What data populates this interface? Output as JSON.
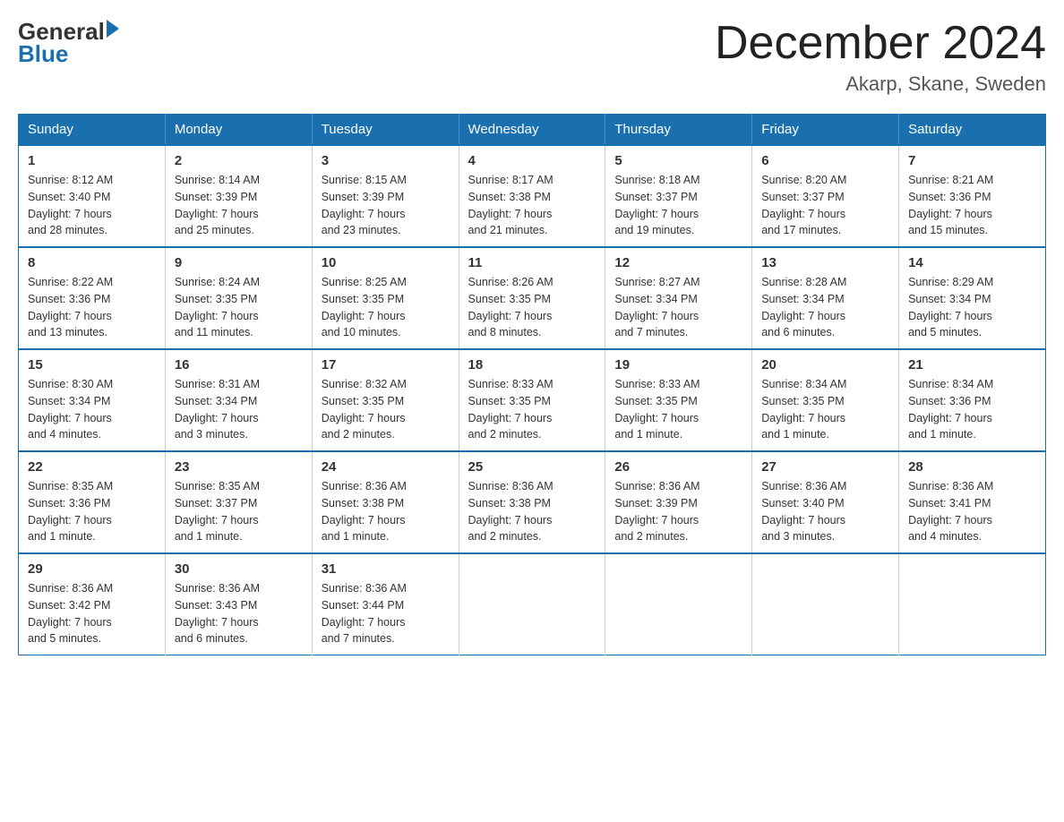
{
  "logo": {
    "general": "General",
    "blue": "Blue",
    "arrow": "▶"
  },
  "title": {
    "month_year": "December 2024",
    "location": "Akarp, Skane, Sweden"
  },
  "headers": [
    "Sunday",
    "Monday",
    "Tuesday",
    "Wednesday",
    "Thursday",
    "Friday",
    "Saturday"
  ],
  "weeks": [
    [
      {
        "day": "1",
        "info": "Sunrise: 8:12 AM\nSunset: 3:40 PM\nDaylight: 7 hours\nand 28 minutes."
      },
      {
        "day": "2",
        "info": "Sunrise: 8:14 AM\nSunset: 3:39 PM\nDaylight: 7 hours\nand 25 minutes."
      },
      {
        "day": "3",
        "info": "Sunrise: 8:15 AM\nSunset: 3:39 PM\nDaylight: 7 hours\nand 23 minutes."
      },
      {
        "day": "4",
        "info": "Sunrise: 8:17 AM\nSunset: 3:38 PM\nDaylight: 7 hours\nand 21 minutes."
      },
      {
        "day": "5",
        "info": "Sunrise: 8:18 AM\nSunset: 3:37 PM\nDaylight: 7 hours\nand 19 minutes."
      },
      {
        "day": "6",
        "info": "Sunrise: 8:20 AM\nSunset: 3:37 PM\nDaylight: 7 hours\nand 17 minutes."
      },
      {
        "day": "7",
        "info": "Sunrise: 8:21 AM\nSunset: 3:36 PM\nDaylight: 7 hours\nand 15 minutes."
      }
    ],
    [
      {
        "day": "8",
        "info": "Sunrise: 8:22 AM\nSunset: 3:36 PM\nDaylight: 7 hours\nand 13 minutes."
      },
      {
        "day": "9",
        "info": "Sunrise: 8:24 AM\nSunset: 3:35 PM\nDaylight: 7 hours\nand 11 minutes."
      },
      {
        "day": "10",
        "info": "Sunrise: 8:25 AM\nSunset: 3:35 PM\nDaylight: 7 hours\nand 10 minutes."
      },
      {
        "day": "11",
        "info": "Sunrise: 8:26 AM\nSunset: 3:35 PM\nDaylight: 7 hours\nand 8 minutes."
      },
      {
        "day": "12",
        "info": "Sunrise: 8:27 AM\nSunset: 3:34 PM\nDaylight: 7 hours\nand 7 minutes."
      },
      {
        "day": "13",
        "info": "Sunrise: 8:28 AM\nSunset: 3:34 PM\nDaylight: 7 hours\nand 6 minutes."
      },
      {
        "day": "14",
        "info": "Sunrise: 8:29 AM\nSunset: 3:34 PM\nDaylight: 7 hours\nand 5 minutes."
      }
    ],
    [
      {
        "day": "15",
        "info": "Sunrise: 8:30 AM\nSunset: 3:34 PM\nDaylight: 7 hours\nand 4 minutes."
      },
      {
        "day": "16",
        "info": "Sunrise: 8:31 AM\nSunset: 3:34 PM\nDaylight: 7 hours\nand 3 minutes."
      },
      {
        "day": "17",
        "info": "Sunrise: 8:32 AM\nSunset: 3:35 PM\nDaylight: 7 hours\nand 2 minutes."
      },
      {
        "day": "18",
        "info": "Sunrise: 8:33 AM\nSunset: 3:35 PM\nDaylight: 7 hours\nand 2 minutes."
      },
      {
        "day": "19",
        "info": "Sunrise: 8:33 AM\nSunset: 3:35 PM\nDaylight: 7 hours\nand 1 minute."
      },
      {
        "day": "20",
        "info": "Sunrise: 8:34 AM\nSunset: 3:35 PM\nDaylight: 7 hours\nand 1 minute."
      },
      {
        "day": "21",
        "info": "Sunrise: 8:34 AM\nSunset: 3:36 PM\nDaylight: 7 hours\nand 1 minute."
      }
    ],
    [
      {
        "day": "22",
        "info": "Sunrise: 8:35 AM\nSunset: 3:36 PM\nDaylight: 7 hours\nand 1 minute."
      },
      {
        "day": "23",
        "info": "Sunrise: 8:35 AM\nSunset: 3:37 PM\nDaylight: 7 hours\nand 1 minute."
      },
      {
        "day": "24",
        "info": "Sunrise: 8:36 AM\nSunset: 3:38 PM\nDaylight: 7 hours\nand 1 minute."
      },
      {
        "day": "25",
        "info": "Sunrise: 8:36 AM\nSunset: 3:38 PM\nDaylight: 7 hours\nand 2 minutes."
      },
      {
        "day": "26",
        "info": "Sunrise: 8:36 AM\nSunset: 3:39 PM\nDaylight: 7 hours\nand 2 minutes."
      },
      {
        "day": "27",
        "info": "Sunrise: 8:36 AM\nSunset: 3:40 PM\nDaylight: 7 hours\nand 3 minutes."
      },
      {
        "day": "28",
        "info": "Sunrise: 8:36 AM\nSunset: 3:41 PM\nDaylight: 7 hours\nand 4 minutes."
      }
    ],
    [
      {
        "day": "29",
        "info": "Sunrise: 8:36 AM\nSunset: 3:42 PM\nDaylight: 7 hours\nand 5 minutes."
      },
      {
        "day": "30",
        "info": "Sunrise: 8:36 AM\nSunset: 3:43 PM\nDaylight: 7 hours\nand 6 minutes."
      },
      {
        "day": "31",
        "info": "Sunrise: 8:36 AM\nSunset: 3:44 PM\nDaylight: 7 hours\nand 7 minutes."
      },
      null,
      null,
      null,
      null
    ]
  ]
}
